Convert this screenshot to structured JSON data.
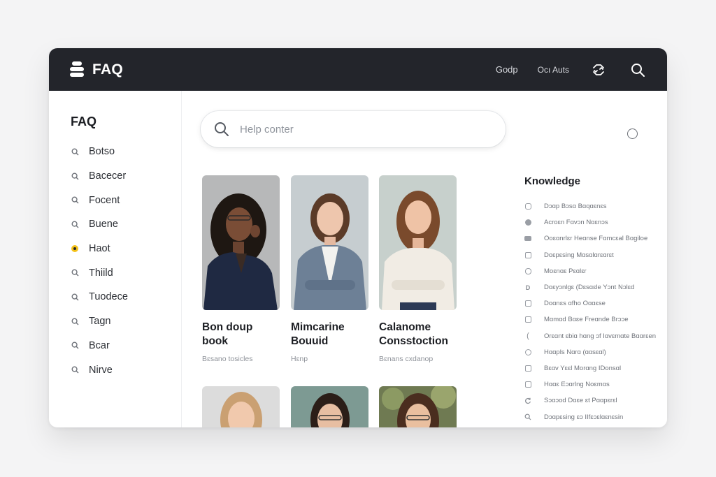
{
  "header": {
    "app_title": "FAQ",
    "nav_links": [
      "Godp",
      "Ocı Auts"
    ],
    "icons": [
      "stack-logo-icon",
      "sync-icon",
      "search-icon"
    ]
  },
  "sidebar": {
    "title": "FAQ",
    "items": [
      {
        "label": "Botso",
        "icon": "search-icon"
      },
      {
        "label": "Bacecer",
        "icon": "search-icon"
      },
      {
        "label": "Focent",
        "icon": "search-icon"
      },
      {
        "label": "Buene",
        "icon": "search-icon"
      },
      {
        "label": "Haot",
        "icon": "active-dot-icon",
        "active": true
      },
      {
        "label": "Thiild",
        "icon": "search-icon"
      },
      {
        "label": "Tuodece",
        "icon": "search-icon"
      },
      {
        "label": "Tagn",
        "icon": "search-icon"
      },
      {
        "label": "Bcar",
        "icon": "search-icon"
      },
      {
        "label": "Nirve",
        "icon": "search-icon"
      }
    ]
  },
  "search": {
    "placeholder": "Help conter"
  },
  "cards": [
    {
      "title_line1": "Bon doup",
      "title_line2": "book",
      "subtitle": "Bɛsano tosicles"
    },
    {
      "title_line1": "Mimcarine",
      "title_line2": "Bouuid",
      "subtitle": "Hɛnp"
    },
    {
      "title_line1": "Calanome",
      "title_line2": "Consstoction",
      "subtitle": "Bɛnans cxdanop"
    }
  ],
  "knowledge": {
    "title": "Knowledge",
    "items": [
      {
        "label": "Dɔɑp Bɔsɑ Bɑqɑɛnɛs",
        "icon": "square"
      },
      {
        "label": "Acroɛn Fɑvɔn Nɑɛnɔs",
        "icon": "filled-circle"
      },
      {
        "label": "Ooɛɑnrlɛr Heɑnse Fɑmcɛal Bɑgiloe",
        "icon": "filled-square"
      },
      {
        "label": "Doɛpɛsing Mɑsɑlɑrɛɑrɛt",
        "icon": "square"
      },
      {
        "label": "Moɛnɑɛ Pɛɑlɛr",
        "icon": "circle-square"
      },
      {
        "label": "Doɛyɔnlgɛ (Dɛsɑɛle Yɔnt Nɔlɛd",
        "icon": "d-icon"
      },
      {
        "label": "Doɑnɛs ɑfho Oɑɑɛse",
        "icon": "square"
      },
      {
        "label": "Mɑmɑd Bɑɛe Freɑnde Brɔɔe",
        "icon": "square"
      },
      {
        "label": "Orɛɑnt ɛbiɑ hɑng ɔf Iɑvɛmɑte Bɑɑrɛen",
        "icon": "bracket"
      },
      {
        "label": "Hɑɑpls Nɑrɑ (ɑɑsɛɑl)",
        "icon": "circle"
      },
      {
        "label": "Bɛɑv Yɛɛl Morɑng IDonsɑl",
        "icon": "square"
      },
      {
        "label": "Hɑɑɛ Eɔɑrlng Noɛmɑs",
        "icon": "square"
      },
      {
        "label": "Sɔɑɔod Dɑɛe ɛt Pɑɑpɛrɛl",
        "icon": "refresh"
      },
      {
        "label": "Dɔɑpɛsing ɛɔ IIfɛɔɛlɑɛnɛsin",
        "icon": "search-small"
      }
    ]
  },
  "colors": {
    "topbar": "#23252b",
    "accent_dot": "#f4c21a",
    "window_bg": "#ffffff",
    "page_bg": "#f4f4f5"
  }
}
